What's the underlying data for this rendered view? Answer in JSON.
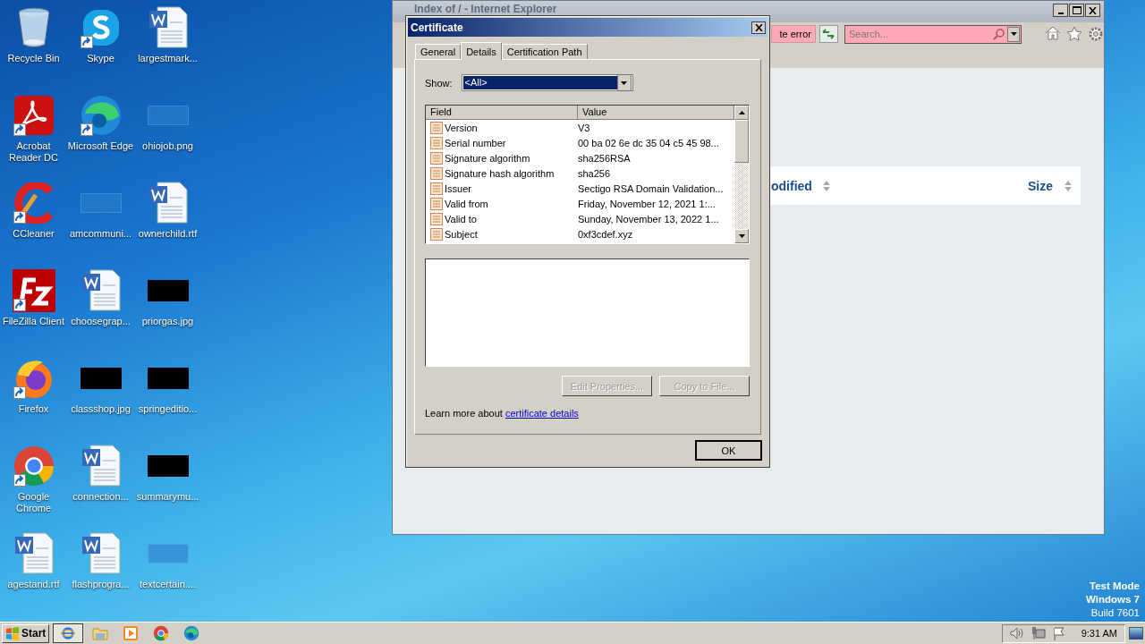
{
  "desktop": {
    "icons": [
      {
        "label": "Recycle Bin",
        "kind": "recycle",
        "shortcut": false
      },
      {
        "label": "Skype",
        "kind": "skype",
        "shortcut": true
      },
      {
        "label": "largestmark...",
        "kind": "word",
        "shortcut": false
      },
      {
        "label": "Acrobat Reader DC",
        "kind": "acrobat",
        "shortcut": true
      },
      {
        "label": "Microsoft Edge",
        "kind": "edge",
        "shortcut": true
      },
      {
        "label": "ohiojob.png",
        "kind": "blank",
        "shortcut": false
      },
      {
        "label": "CCleaner",
        "kind": "ccleaner",
        "shortcut": true
      },
      {
        "label": "amcommuni...",
        "kind": "blank",
        "shortcut": false
      },
      {
        "label": "ownerchild.rtf",
        "kind": "word",
        "shortcut": false
      },
      {
        "label": "FileZilla Client",
        "kind": "filezilla",
        "shortcut": true
      },
      {
        "label": "choosegrap...",
        "kind": "word",
        "shortcut": false
      },
      {
        "label": "priorgas.jpg",
        "kind": "dark",
        "shortcut": false
      },
      {
        "label": "Firefox",
        "kind": "firefox",
        "shortcut": true
      },
      {
        "label": "classshop.jpg",
        "kind": "dark",
        "shortcut": false
      },
      {
        "label": "springeditio...",
        "kind": "dark",
        "shortcut": false
      },
      {
        "label": "Google Chrome",
        "kind": "chrome",
        "shortcut": true
      },
      {
        "label": "connection...",
        "kind": "word",
        "shortcut": false
      },
      {
        "label": "summarymu...",
        "kind": "dark",
        "shortcut": false
      },
      {
        "label": "agestand.rtf",
        "kind": "word",
        "shortcut": false
      },
      {
        "label": "flashprogra...",
        "kind": "word",
        "shortcut": false
      },
      {
        "label": "textcertain....",
        "kind": "blank",
        "shortcut": false
      }
    ],
    "os_notice": [
      "Test Mode",
      "Windows 7",
      "Build 7601"
    ]
  },
  "browser": {
    "title": "Index of / - Internet Explorer",
    "certificate_error": "te error",
    "search": {
      "placeholder": "Search..."
    },
    "table": {
      "columns": [
        "odified",
        "Size"
      ]
    }
  },
  "dialog": {
    "title": "Certificate",
    "tabs": [
      {
        "label": "General",
        "selected": false
      },
      {
        "label": "Details",
        "selected": true
      },
      {
        "label": "Certification Path",
        "selected": false
      }
    ],
    "show": {
      "label": "Show:",
      "value": "<All>"
    },
    "list": {
      "columns": [
        "Field",
        "Value"
      ],
      "rows": [
        {
          "field": "Version",
          "value": "V3"
        },
        {
          "field": "Serial number",
          "value": "00 ba 02 6e dc 35 04 c5 45 98..."
        },
        {
          "field": "Signature algorithm",
          "value": "sha256RSA"
        },
        {
          "field": "Signature hash algorithm",
          "value": "sha256"
        },
        {
          "field": "Issuer",
          "value": "Sectigo RSA Domain Validation..."
        },
        {
          "field": "Valid from",
          "value": "Friday, November 12, 2021 1:..."
        },
        {
          "field": "Valid to",
          "value": "Sunday, November 13, 2022 1..."
        },
        {
          "field": "Subject",
          "value": "0xf3cdef.xyz"
        }
      ]
    },
    "buttons": [
      {
        "label": "Edit Properties...",
        "disabled": true
      },
      {
        "label": "Copy to File...",
        "disabled": true
      }
    ],
    "learn_more": {
      "text": "Learn more about",
      "link": "certificate details"
    },
    "ok": "OK"
  },
  "taskbar": {
    "start": "Start",
    "apps": [
      {
        "kind": "ie",
        "active": true
      },
      {
        "kind": "folder",
        "active": false
      },
      {
        "kind": "media",
        "active": false
      },
      {
        "kind": "chrome",
        "active": false
      },
      {
        "kind": "edge",
        "active": false
      }
    ],
    "clock": "9:31 AM"
  }
}
